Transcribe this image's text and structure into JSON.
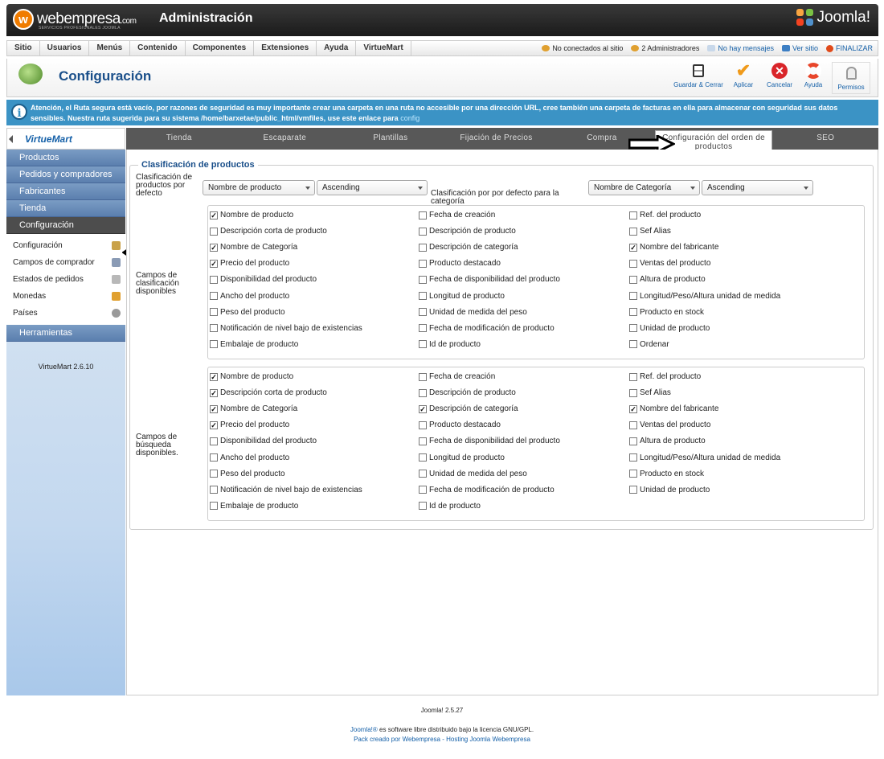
{
  "brand": {
    "name": "webempresa",
    "suffix": ".com",
    "tagline": "SERVICIOS PROFESIONALES JOOMLA",
    "admin_title": "Administración",
    "joomla_logo": "Joomla!"
  },
  "menu": [
    "Sitio",
    "Usuarios",
    "Menús",
    "Contenido",
    "Componentes",
    "Extensiones",
    "Ayuda",
    "VirtueMart"
  ],
  "status": {
    "offline": "No conectados al sitio",
    "admins": "2 Administradores",
    "messages": "No hay mensajes",
    "view_site": "Ver sitio",
    "logout": "FINALIZAR"
  },
  "toolbar": {
    "title": "Configuración",
    "save_close": "Guardar & Cerrar",
    "apply": "Aplicar",
    "cancel": "Cancelar",
    "help": "Ayuda",
    "permissions": "Permisos"
  },
  "notice": {
    "text": "Atención, el Ruta segura está vacío, por razones de seguridad es muy importante crear una carpeta en una ruta no accesible por una dirección URL, cree también una carpeta de facturas en ella para almacenar con seguridad sus datos sensibles. Nuestra ruta sugerida para su sistema /home/barxetae/public_html/vmfiles, use este enlace para",
    "link": "config"
  },
  "sidebar": {
    "logo": "VirtueMart",
    "sections": [
      "Productos",
      "Pedidos y compradores",
      "Fabricantes",
      "Tienda"
    ],
    "active_section": "Configuración",
    "sub_items": [
      {
        "label": "Configuración",
        "icon": "tools-icon",
        "color": "#c9a24a"
      },
      {
        "label": "Campos de comprador",
        "icon": "form-icon",
        "color": "#8a9bb5"
      },
      {
        "label": "Estados de pedidos",
        "icon": "status-icon",
        "color": "#b8b8b8"
      },
      {
        "label": "Monedas",
        "icon": "coins-icon",
        "color": "#e0a030"
      },
      {
        "label": "Países",
        "icon": "globe-icon",
        "color": "#9a9a9a"
      }
    ],
    "tools": "Herramientas",
    "version": "VirtueMart 2.6.10"
  },
  "tabs": [
    "Tienda",
    "Escaparate",
    "Plantillas",
    "Fijación de Precios",
    "Compra",
    "Configuración del orden de productos",
    "SEO"
  ],
  "active_tab": "Configuración del orden de productos",
  "section": {
    "legend": "Clasificación de productos",
    "default_label": "Clasificación de productos por defecto",
    "default_field": "Nombre de producto",
    "default_dir": "Ascending",
    "category_label": "Clasificación por por defecto para la categoría",
    "category_field": "Nombre de Categoría",
    "category_dir": "Ascending",
    "sort_label": "Campos de clasificación disponibles",
    "search_label": "Campos de búsqueda disponibles."
  },
  "sort_fields": [
    [
      "Nombre de producto",
      true
    ],
    [
      "Descripción corta de producto",
      false
    ],
    [
      "Nombre de Categoría",
      true
    ],
    [
      "Precio del producto",
      true
    ],
    [
      "Disponibilidad del producto",
      false
    ],
    [
      "Ancho del producto",
      false
    ],
    [
      "Peso del producto",
      false
    ],
    [
      "Notificación de nivel bajo de existencias",
      false
    ],
    [
      "Embalaje de producto",
      false
    ],
    [
      "Fecha de creación",
      false
    ],
    [
      "Descripción de producto",
      false
    ],
    [
      "Descripción de categoría",
      false
    ],
    [
      "Producto destacado",
      false
    ],
    [
      "Fecha de disponibilidad del producto",
      false
    ],
    [
      "Longitud de producto",
      false
    ],
    [
      "Unidad de medida del peso",
      false
    ],
    [
      "Fecha de modificación de producto",
      false
    ],
    [
      "Id de producto",
      false
    ],
    [
      "Ref. del producto",
      false
    ],
    [
      "Sef Alias",
      false
    ],
    [
      "Nombre del fabricante",
      true
    ],
    [
      "Ventas del producto",
      false
    ],
    [
      "Altura de producto",
      false
    ],
    [
      "Longitud/Peso/Altura unidad de medida",
      false
    ],
    [
      "Producto en stock",
      false
    ],
    [
      "Unidad de producto",
      false
    ],
    [
      "Ordenar",
      false
    ]
  ],
  "search_fields": [
    [
      "Nombre de producto",
      true
    ],
    [
      "Descripción corta de producto",
      true
    ],
    [
      "Nombre de Categoría",
      true
    ],
    [
      "Precio del producto",
      true
    ],
    [
      "Disponibilidad del producto",
      false
    ],
    [
      "Ancho del producto",
      false
    ],
    [
      "Peso del producto",
      false
    ],
    [
      "Notificación de nivel bajo de existencias",
      false
    ],
    [
      "Embalaje de producto",
      false
    ],
    [
      "Fecha de creación",
      false
    ],
    [
      "Descripción de producto",
      false
    ],
    [
      "Descripción de categoría",
      true
    ],
    [
      "Producto destacado",
      false
    ],
    [
      "Fecha de disponibilidad del producto",
      false
    ],
    [
      "Longitud de producto",
      false
    ],
    [
      "Unidad de medida del peso",
      false
    ],
    [
      "Fecha de modificación de producto",
      false
    ],
    [
      "Id de producto",
      false
    ],
    [
      "Ref. del producto",
      false
    ],
    [
      "Sef Alias",
      false
    ],
    [
      "Nombre del fabricante",
      true
    ],
    [
      "Ventas del producto",
      false
    ],
    [
      "Altura de producto",
      false
    ],
    [
      "Longitud/Peso/Altura unidad de medida",
      false
    ],
    [
      "Producto en stock",
      false
    ],
    [
      "Unidad de producto",
      false
    ]
  ],
  "footer": {
    "version": "Joomla! 2.5.27",
    "license_link": "Joomla!®",
    "license_text": " es software libre distribuido bajo la licencia GNU/GPL.",
    "pack": "Pack creado por Webempresa - Hosting Joomla Webempresa"
  }
}
